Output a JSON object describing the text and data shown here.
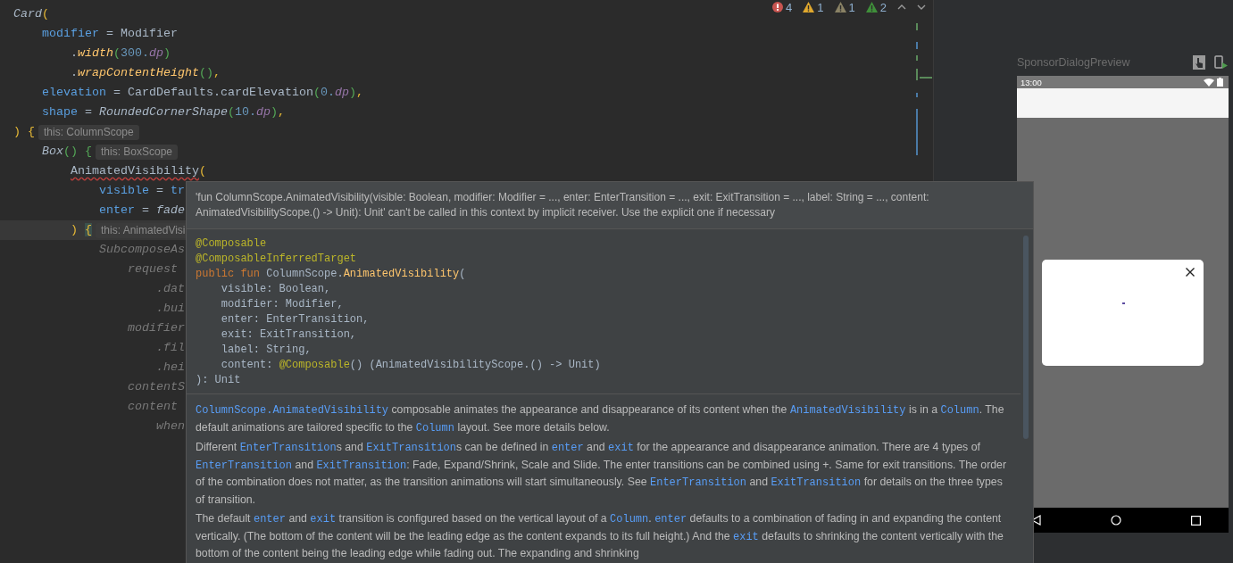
{
  "editor": {
    "lines": [
      {
        "current": false,
        "tokens": [
          {
            "kind": "fn",
            "text": "Card"
          },
          {
            "kind": "p1",
            "text": "("
          }
        ]
      },
      {
        "current": false,
        "tokens": [
          {
            "kind": "param",
            "text": "    modifier"
          },
          {
            "kind": "plain",
            "text": " = Modifier"
          }
        ]
      },
      {
        "current": false,
        "tokens": [
          {
            "kind": "plain",
            "text": "        ."
          },
          {
            "kind": "call",
            "text": "width"
          },
          {
            "kind": "p2",
            "text": "("
          },
          {
            "kind": "num",
            "text": "300."
          },
          {
            "kind": "ext",
            "text": "dp"
          },
          {
            "kind": "p2",
            "text": ")"
          }
        ]
      },
      {
        "current": false,
        "tokens": [
          {
            "kind": "plain",
            "text": "        ."
          },
          {
            "kind": "call",
            "text": "wrapContentHeight"
          },
          {
            "kind": "p2",
            "text": "()"
          },
          {
            "kind": "p1",
            "text": ","
          }
        ]
      },
      {
        "current": false,
        "tokens": [
          {
            "kind": "param",
            "text": "    elevation"
          },
          {
            "kind": "plain",
            "text": " = CardDefaults.cardElevation"
          },
          {
            "kind": "p2",
            "text": "("
          },
          {
            "kind": "num",
            "text": "0."
          },
          {
            "kind": "ext",
            "text": "dp"
          },
          {
            "kind": "p2",
            "text": ")"
          },
          {
            "kind": "p1",
            "text": ","
          }
        ]
      },
      {
        "current": false,
        "tokens": [
          {
            "kind": "param",
            "text": "    shape"
          },
          {
            "kind": "plain",
            "text": " = "
          },
          {
            "kind": "fn",
            "text": "RoundedCornerShape"
          },
          {
            "kind": "p2",
            "text": "("
          },
          {
            "kind": "num",
            "text": "10."
          },
          {
            "kind": "ext",
            "text": "dp"
          },
          {
            "kind": "p2",
            "text": ")"
          },
          {
            "kind": "p1",
            "text": ","
          }
        ]
      },
      {
        "current": false,
        "tokens": [
          {
            "kind": "p1",
            "text": ")"
          },
          {
            "kind": "p1",
            "text": " {"
          }
        ],
        "hint": "this: ColumnScope"
      },
      {
        "current": false,
        "tokens": [
          {
            "kind": "fn",
            "text": "    Box"
          },
          {
            "kind": "p2",
            "text": "()"
          },
          {
            "kind": "p2",
            "text": " {"
          }
        ],
        "hint": "this: BoxScope"
      },
      {
        "current": false,
        "tokens": [
          {
            "kind": "error",
            "text": "        AnimatedVisibility"
          },
          {
            "kind": "p1",
            "text": "("
          }
        ]
      },
      {
        "current": false,
        "tokens": [
          {
            "kind": "param",
            "text": "            visible"
          },
          {
            "kind": "plain",
            "text": " = "
          },
          {
            "kind": "param",
            "text": "tr"
          }
        ]
      },
      {
        "current": false,
        "tokens": [
          {
            "kind": "param",
            "text": "            enter"
          },
          {
            "kind": "plain",
            "text": " = "
          },
          {
            "kind": "fn",
            "text": "fade"
          }
        ]
      },
      {
        "current": true,
        "tokens": [
          {
            "kind": "p1",
            "text": "        ) "
          },
          {
            "kind": "match",
            "text": "{"
          }
        ],
        "hint": "this: AnimatedVisi"
      },
      {
        "current": false,
        "tokens": [
          {
            "kind": "dim",
            "text": "            SubcomposeAs"
          }
        ]
      },
      {
        "current": false,
        "tokens": [
          {
            "kind": "dim",
            "text": "                request"
          }
        ]
      },
      {
        "current": false,
        "tokens": [
          {
            "kind": "dim",
            "text": "                    .dat"
          }
        ]
      },
      {
        "current": false,
        "tokens": [
          {
            "kind": "dim",
            "text": "                    .bui"
          }
        ]
      },
      {
        "current": false,
        "tokens": [
          {
            "kind": "dim",
            "text": "                modifier"
          }
        ]
      },
      {
        "current": false,
        "tokens": [
          {
            "kind": "dim",
            "text": "                    .fil"
          }
        ]
      },
      {
        "current": false,
        "tokens": [
          {
            "kind": "dim",
            "text": "                    .hei"
          }
        ]
      },
      {
        "current": false,
        "tokens": [
          {
            "kind": "dim",
            "text": "                contentS"
          }
        ]
      },
      {
        "current": false,
        "tokens": [
          {
            "kind": "dim",
            "text": "                content"
          }
        ]
      },
      {
        "current": false,
        "tokens": [
          {
            "kind": "dim",
            "text": "                    when"
          }
        ]
      }
    ],
    "problems": [
      {
        "kind": "error",
        "count": "4"
      },
      {
        "kind": "warning",
        "count": "1"
      },
      {
        "kind": "weak",
        "count": "1"
      },
      {
        "kind": "typo",
        "count": "2"
      }
    ]
  },
  "popup": {
    "message": "'fun ColumnScope.AnimatedVisibility(visible: Boolean, modifier: Modifier = ..., enter: EnterTransition = ..., exit: ExitTransition = ..., label: String = ..., content: AnimatedVisibilityScope.() -> Unit): Unit' can't be called in this context by implicit receiver. Use the explicit one if necessary",
    "signature": [
      {
        "tokens": [
          {
            "kind": "anno",
            "text": "@Composable"
          }
        ]
      },
      {
        "tokens": [
          {
            "kind": "anno",
            "text": "@ComposableInferredTarget"
          }
        ]
      },
      {
        "tokens": [
          {
            "kind": "kw",
            "text": "public fun "
          },
          {
            "kind": "plain",
            "text": "ColumnScope."
          },
          {
            "kind": "name",
            "text": "AnimatedVisibility"
          },
          {
            "kind": "plain",
            "text": "("
          }
        ]
      },
      {
        "tokens": [
          {
            "kind": "plain",
            "text": "    visible: Boolean,"
          }
        ]
      },
      {
        "tokens": [
          {
            "kind": "plain",
            "text": "    modifier: Modifier,"
          }
        ]
      },
      {
        "tokens": [
          {
            "kind": "plain",
            "text": "    enter: EnterTransition,"
          }
        ]
      },
      {
        "tokens": [
          {
            "kind": "plain",
            "text": "    exit: ExitTransition,"
          }
        ]
      },
      {
        "tokens": [
          {
            "kind": "plain",
            "text": "    label: String,"
          }
        ]
      },
      {
        "tokens": [
          {
            "kind": "plain",
            "text": "    content: "
          },
          {
            "kind": "anno",
            "text": "@Composable"
          },
          {
            "kind": "plain",
            "text": "() (AnimatedVisibilityScope.() -> Unit)"
          }
        ]
      },
      {
        "tokens": [
          {
            "kind": "plain",
            "text": "): Unit"
          }
        ]
      }
    ],
    "paragraphs": [
      [
        {
          "code": true,
          "text": "ColumnScope.AnimatedVisibility"
        },
        {
          "code": false,
          "text": " composable animates the appearance and disappearance of its content when the "
        },
        {
          "code": true,
          "text": "AnimatedVisibility"
        },
        {
          "code": false,
          "text": " is in a "
        },
        {
          "code": true,
          "text": "Column"
        },
        {
          "code": false,
          "text": ". The default animations are tailored specific to the "
        },
        {
          "code": true,
          "text": "Column"
        },
        {
          "code": false,
          "text": " layout. See more details below."
        }
      ],
      [
        {
          "code": false,
          "text": "Different "
        },
        {
          "code": true,
          "text": "EnterTransition"
        },
        {
          "code": false,
          "text": "s and "
        },
        {
          "code": true,
          "text": "ExitTransition"
        },
        {
          "code": false,
          "text": "s can be defined in "
        },
        {
          "code": true,
          "text": "enter"
        },
        {
          "code": false,
          "text": " and "
        },
        {
          "code": true,
          "text": "exit"
        },
        {
          "code": false,
          "text": " for the appearance and disappearance animation. There are 4 types of "
        },
        {
          "code": true,
          "text": "EnterTransition"
        },
        {
          "code": false,
          "text": " and "
        },
        {
          "code": true,
          "text": "ExitTransition"
        },
        {
          "code": false,
          "text": ": Fade, Expand/Shrink, Scale and Slide. The enter transitions can be combined using +. Same for exit transitions. The order of the combination does not matter, as the transition animations will start simultaneously. See "
        },
        {
          "code": true,
          "text": "EnterTransition"
        },
        {
          "code": false,
          "text": " and "
        },
        {
          "code": true,
          "text": "ExitTransition"
        },
        {
          "code": false,
          "text": " for details on the three types of transition."
        }
      ],
      [
        {
          "code": false,
          "text": "The default "
        },
        {
          "code": true,
          "text": "enter"
        },
        {
          "code": false,
          "text": " and "
        },
        {
          "code": true,
          "text": "exit"
        },
        {
          "code": false,
          "text": " transition is configured based on the vertical layout of a "
        },
        {
          "code": true,
          "text": "Column"
        },
        {
          "code": false,
          "text": ". "
        },
        {
          "code": true,
          "text": "enter"
        },
        {
          "code": false,
          "text": " defaults to a combination of fading in and expanding the content vertically. (The bottom of the content will be the leading edge as the content expands to its full height.) And the "
        },
        {
          "code": true,
          "text": "exit"
        },
        {
          "code": false,
          "text": " defaults to shrinking the content vertically with the bottom of the content being the leading edge while fading out. The expanding and shrinking"
        }
      ]
    ]
  },
  "preview": {
    "title": "SponsorDialogPreview",
    "status_time": "13:00"
  }
}
